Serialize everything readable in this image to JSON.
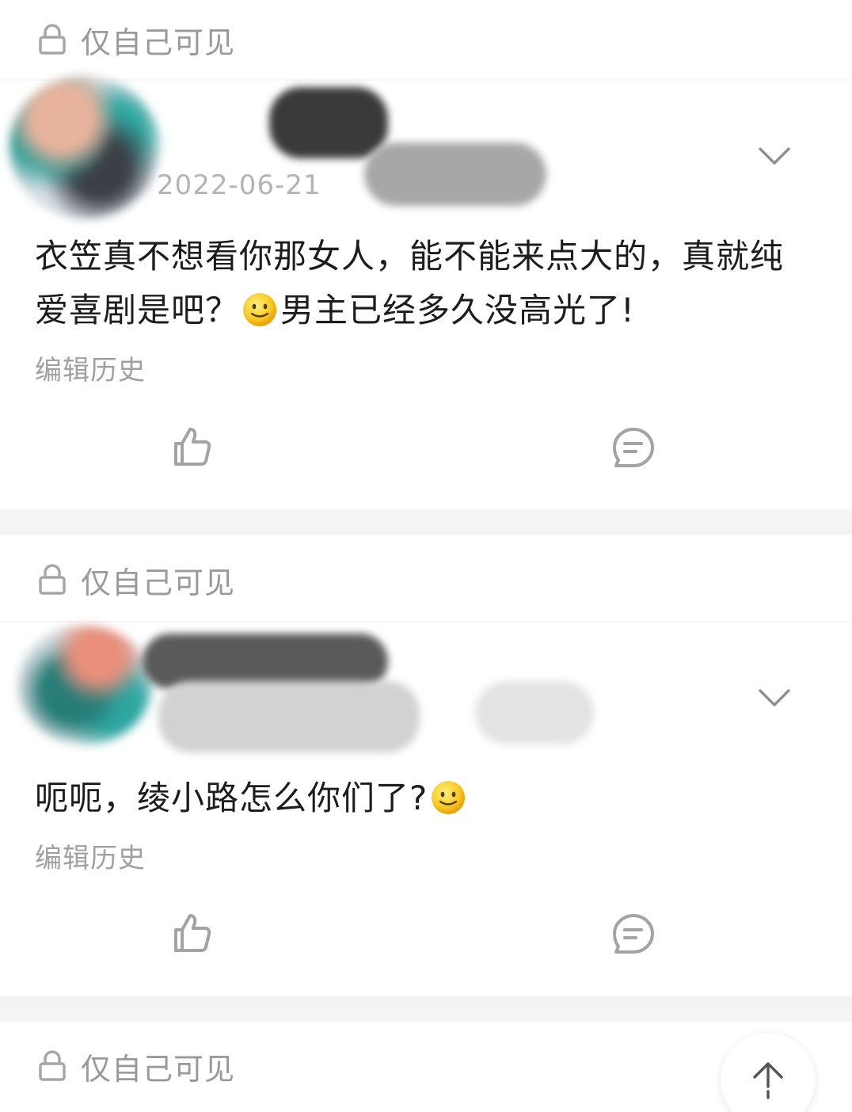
{
  "feed": {
    "posts": [
      {
        "privacy_label": "仅自己可见",
        "date": "2022-06-21",
        "text_before_emoji": "衣笠真不想看你那女人，能不能来点大的，真就纯爱喜剧是吧？",
        "text_after_emoji": "男主已经多久没高光了!",
        "edit_history_label": "编辑历史"
      },
      {
        "privacy_label": "仅自己可见",
        "text_before_emoji": "呃呃，绫小路怎么你们了?",
        "text_after_emoji": "",
        "edit_history_label": "编辑历史"
      },
      {
        "privacy_label": "仅自己可见"
      }
    ]
  },
  "icons": {
    "lock": "lock-icon",
    "chevron": "chevron-down-icon",
    "like": "thumbs-up-icon",
    "comment": "comment-icon",
    "emoji": "smile-emoji-icon",
    "scroll_top": "arrow-up-icon"
  },
  "colors": {
    "muted_text": "#9a9a9a",
    "body_text": "#1d1d1d",
    "divider": "#f4f4f4"
  }
}
